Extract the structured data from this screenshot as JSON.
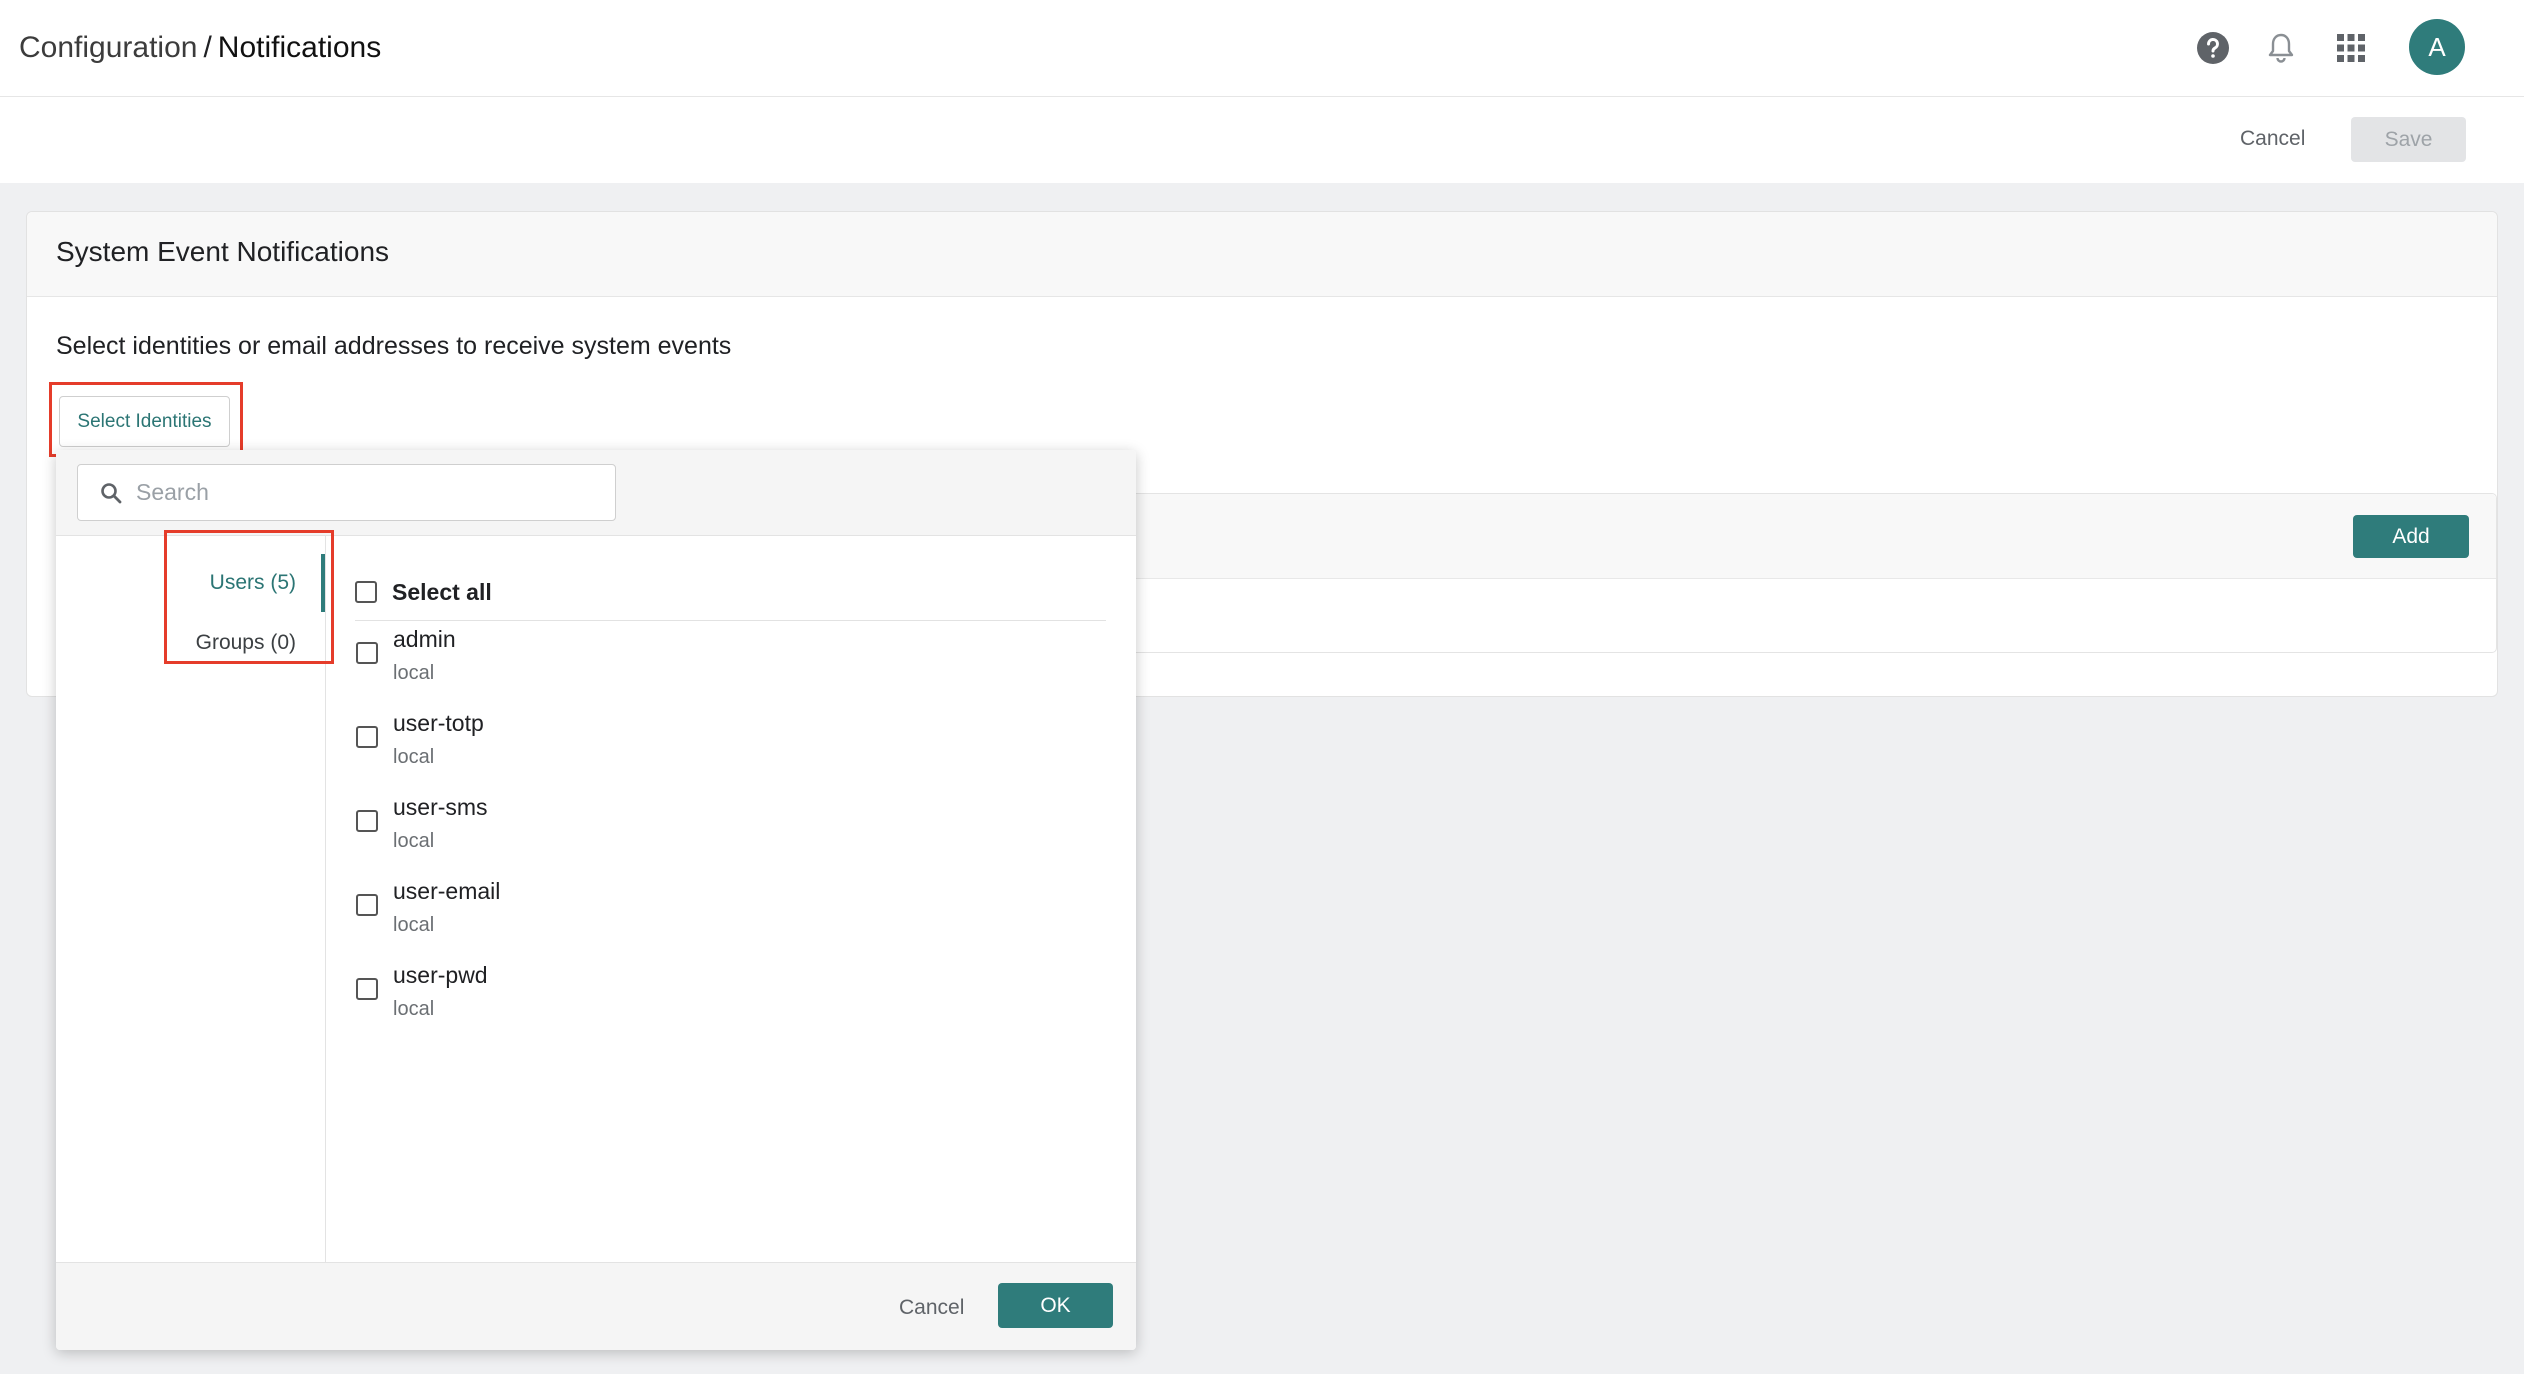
{
  "header": {
    "breadcrumb_parent": "Configuration",
    "breadcrumb_separator": "/",
    "breadcrumb_current": "Notifications",
    "icons": [
      "help-icon",
      "bell-icon",
      "apps-grid-icon"
    ],
    "avatar_initial": "A"
  },
  "actions": {
    "cancel_label": "Cancel",
    "save_label": "Save"
  },
  "card": {
    "title": "System Event Notifications",
    "description": "Select identities or email addresses to receive system events",
    "select_identities_label": "Select Identities",
    "add_label": "Add"
  },
  "popup": {
    "search_placeholder": "Search",
    "tabs": [
      {
        "label": "Users (5)",
        "active": true
      },
      {
        "label": "Groups (0)",
        "active": false
      }
    ],
    "select_all_label": "Select all",
    "users": [
      {
        "name": "admin",
        "source": "local"
      },
      {
        "name": "user-totp",
        "source": "local"
      },
      {
        "name": "user-sms",
        "source": "local"
      },
      {
        "name": "user-email",
        "source": "local"
      },
      {
        "name": "user-pwd",
        "source": "local"
      }
    ],
    "cancel_label": "Cancel",
    "ok_label": "OK"
  },
  "colors": {
    "accent": "#2f7c7b",
    "highlight": "#e53c2a"
  }
}
